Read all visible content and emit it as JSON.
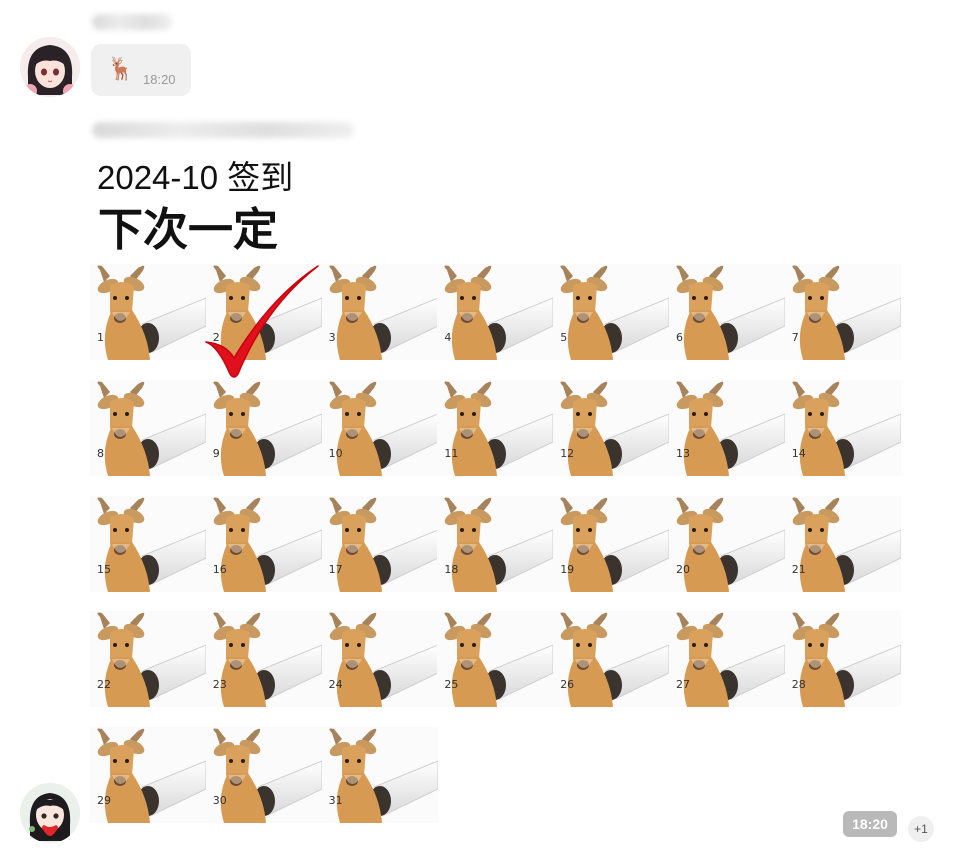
{
  "messages": [
    {
      "sender": "user-1",
      "type": "emoji",
      "content": "🦌",
      "time": "18:20"
    },
    {
      "sender": "user-2",
      "type": "image",
      "image": {
        "title": "2024-10 签到",
        "subtitle": "下次一定",
        "days": [
          "1",
          "2",
          "3",
          "4",
          "5",
          "6",
          "7",
          "8",
          "9",
          "10",
          "11",
          "12",
          "13",
          "14",
          "15",
          "16",
          "17",
          "18",
          "19",
          "20",
          "21",
          "22",
          "23",
          "24",
          "25",
          "26",
          "27",
          "28",
          "29",
          "30",
          "31"
        ],
        "checked_day": "2"
      },
      "time": "18:20",
      "reaction": "+1"
    }
  ],
  "colors": {
    "check": "#e0111d",
    "bubble": "#f0f0f0",
    "time_badge": "#b9b9b9"
  }
}
